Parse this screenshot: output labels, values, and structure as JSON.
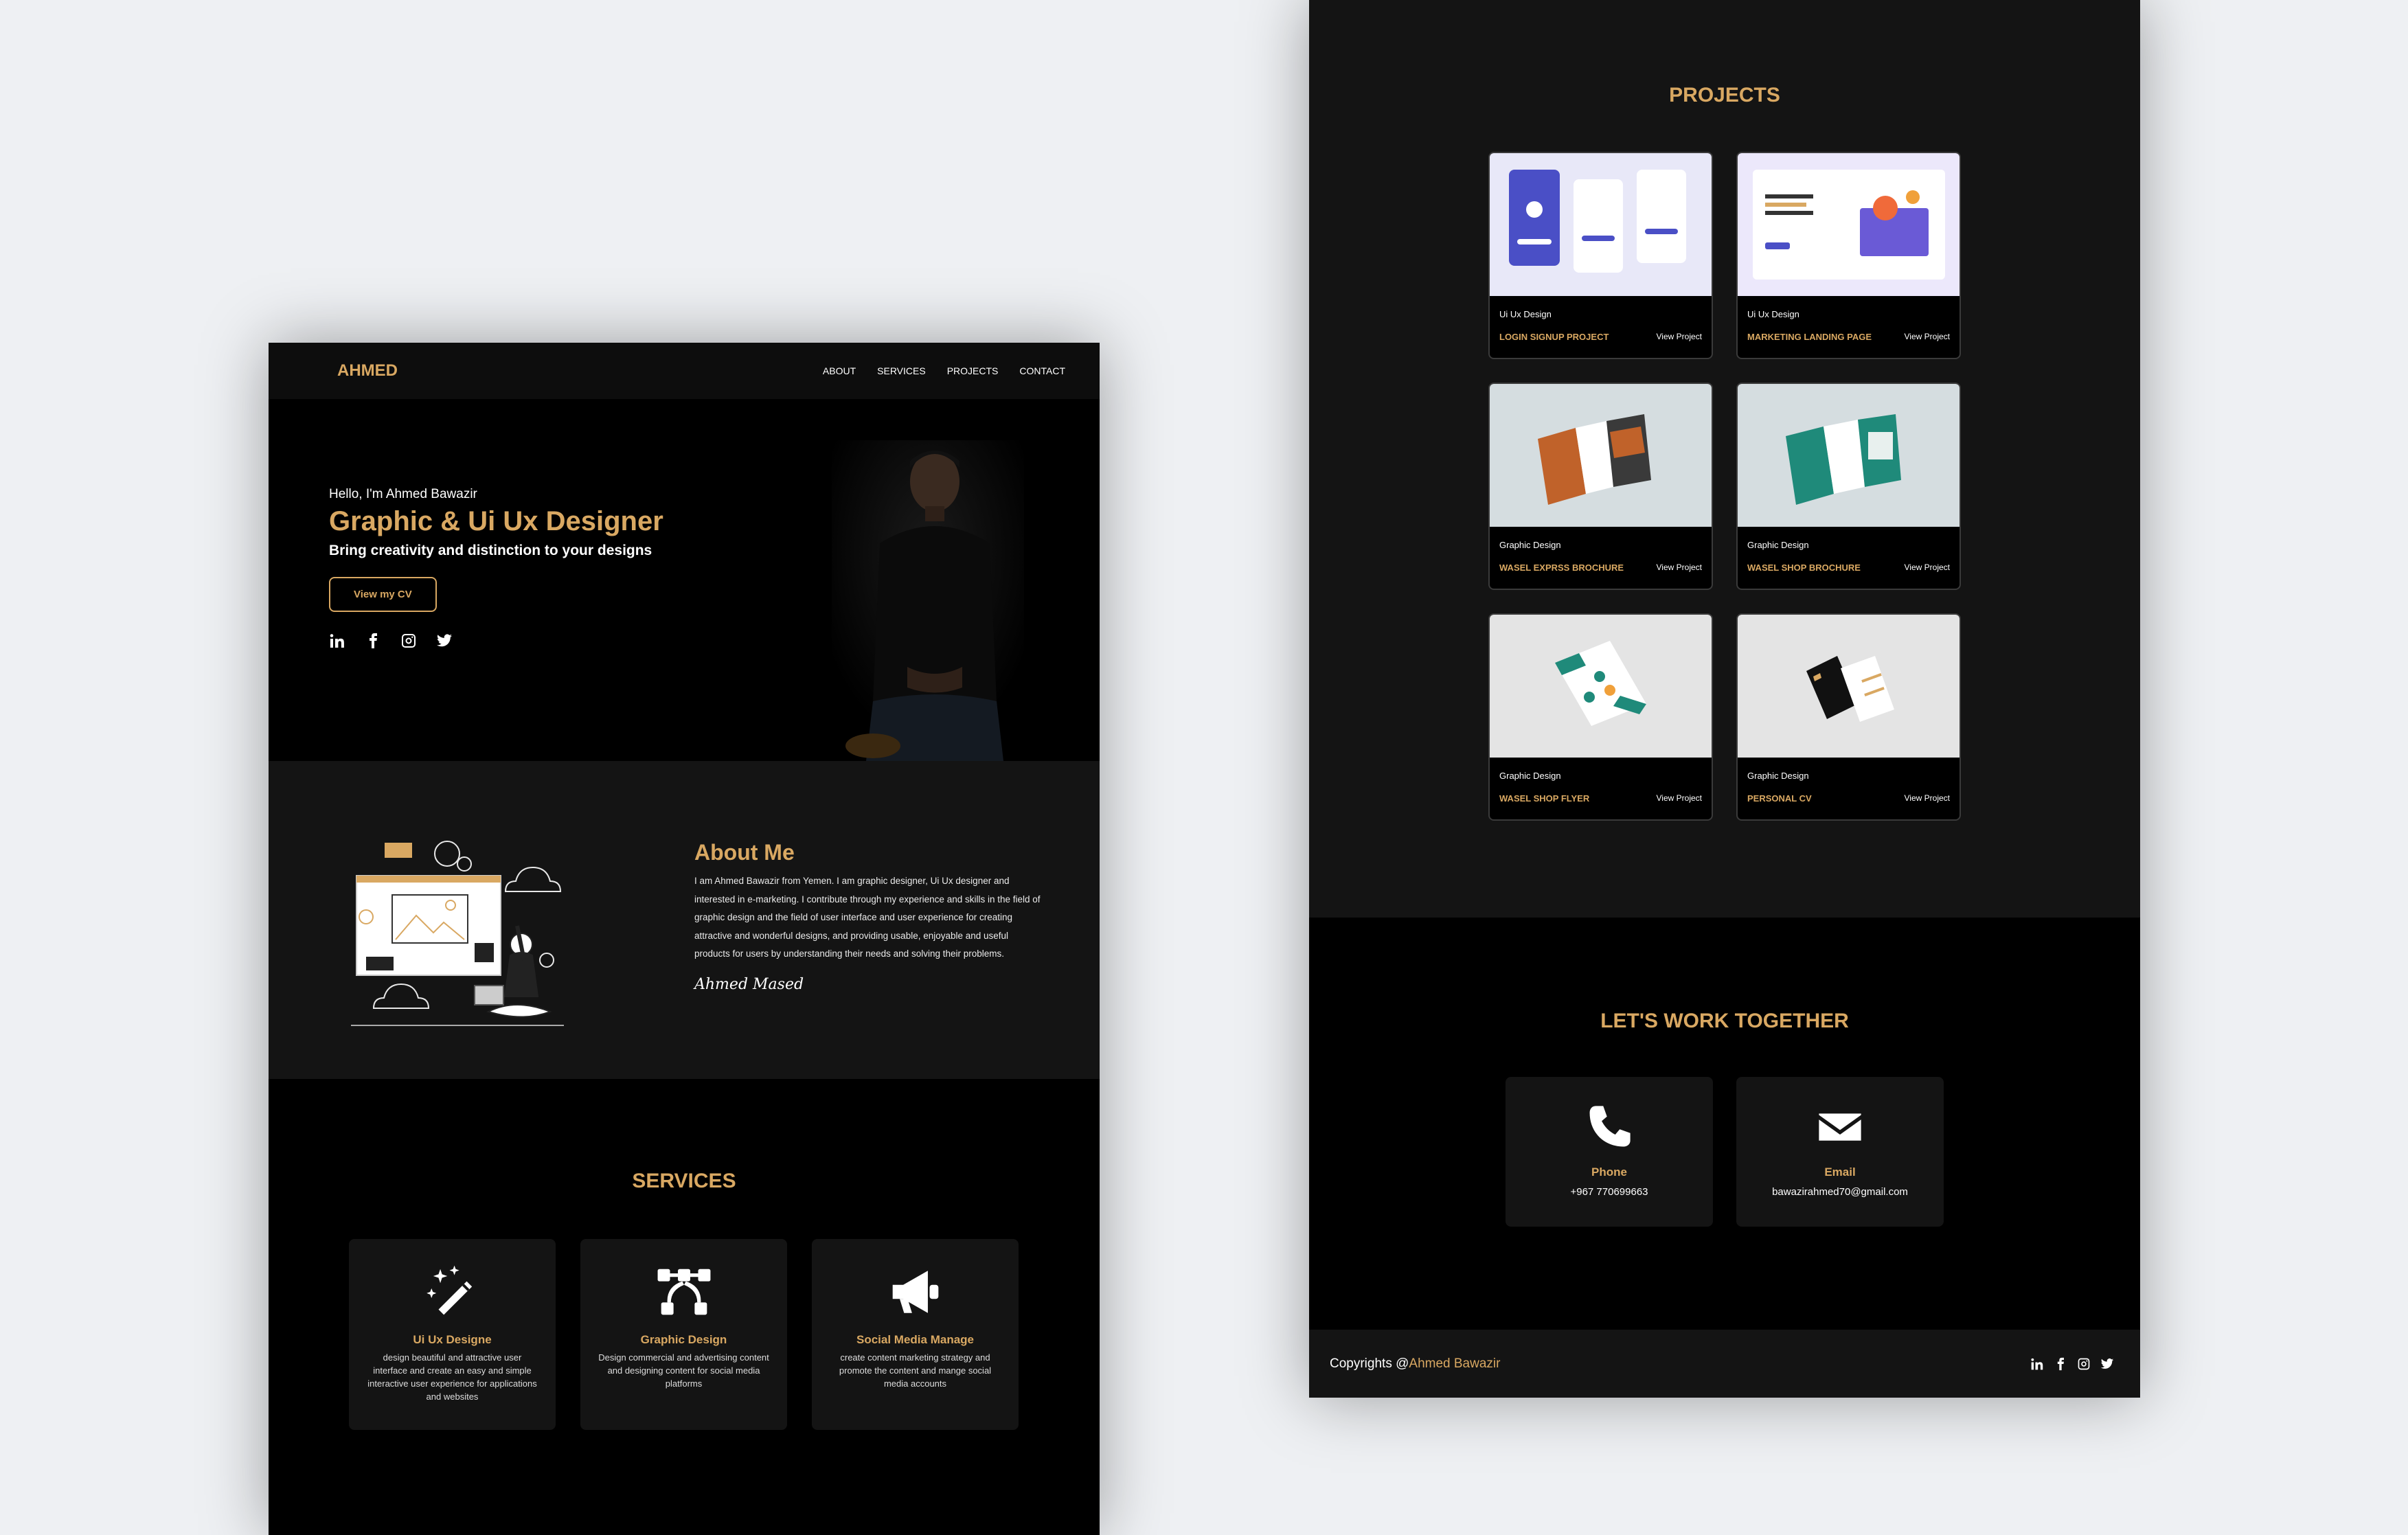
{
  "nav": {
    "logo": "AHMED",
    "items": [
      "ABOUT",
      "SERVICES",
      "PROJECTS",
      "CONTACT"
    ]
  },
  "hero": {
    "greeting": "Hello, I'm Ahmed Bawazir",
    "title": "Graphic & Ui Ux Designer",
    "subtitle": "Bring creativity and distinction to your designs",
    "cta": "View my CV",
    "socials": [
      "linkedin-icon",
      "facebook-icon",
      "instagram-icon",
      "twitter-icon"
    ]
  },
  "about": {
    "title": "About Me",
    "body": "I am Ahmed Bawazir from Yemen. I am graphic designer, Ui Ux designer and interested in e-marketing. I contribute through my experience and skills in the field of graphic design and the field of user interface and user experience for creating attractive and wonderful designs, and providing usable, enjoyable and useful products for users by understanding their needs and solving their problems.",
    "signature": "Ahmed Mased"
  },
  "services": {
    "title": "SERVICES",
    "items": [
      {
        "name": "Ui Ux Designe",
        "desc": "design beautiful and attractive user interface and create an easy and simple interactive user experience for applications and websites",
        "icon": "magic-wand-icon"
      },
      {
        "name": "Graphic Design",
        "desc": "Design commercial and advertising content and designing content for social media platforms",
        "icon": "vector-nodes-icon"
      },
      {
        "name": "Social Media Manage",
        "desc": "create content marketing strategy and promote the content and mange social media accounts",
        "icon": "megaphone-icon"
      }
    ]
  },
  "projects": {
    "title": "PROJECTS",
    "items": [
      {
        "category": "Ui Ux Design",
        "name": "LOGIN SIGNUP PROJECT",
        "link": "View Project"
      },
      {
        "category": "Ui Ux Design",
        "name": "MARKETING LANDING PAGE",
        "link": "View Project"
      },
      {
        "category": "Graphic Design",
        "name": "WASEL EXPRSS BROCHURE",
        "link": "View Project"
      },
      {
        "category": "Graphic Design",
        "name": "WASEL SHOP BROCHURE",
        "link": "View Project"
      },
      {
        "category": "Graphic Design",
        "name": "WASEL SHOP FLYER",
        "link": "View Project"
      },
      {
        "category": "Graphic Design",
        "name": "PERSONAL CV",
        "link": "View Project"
      }
    ]
  },
  "contact": {
    "title": "LET'S WORK TOGETHER",
    "items": [
      {
        "label": "Phone",
        "value": "+967 770699663",
        "icon": "phone-icon"
      },
      {
        "label": "Email",
        "value": "bawazirahmed70@gmail.com",
        "icon": "envelope-icon"
      }
    ]
  },
  "footer": {
    "prefix": "Copyrights @",
    "name": "Ahmed Bawazir",
    "socials": [
      "linkedin-icon",
      "facebook-icon",
      "instagram-icon",
      "twitter-icon"
    ]
  },
  "colors": {
    "accent": "#d9a862",
    "background": "#000000",
    "panel": "#141414",
    "canvas": "#eef0f3"
  }
}
